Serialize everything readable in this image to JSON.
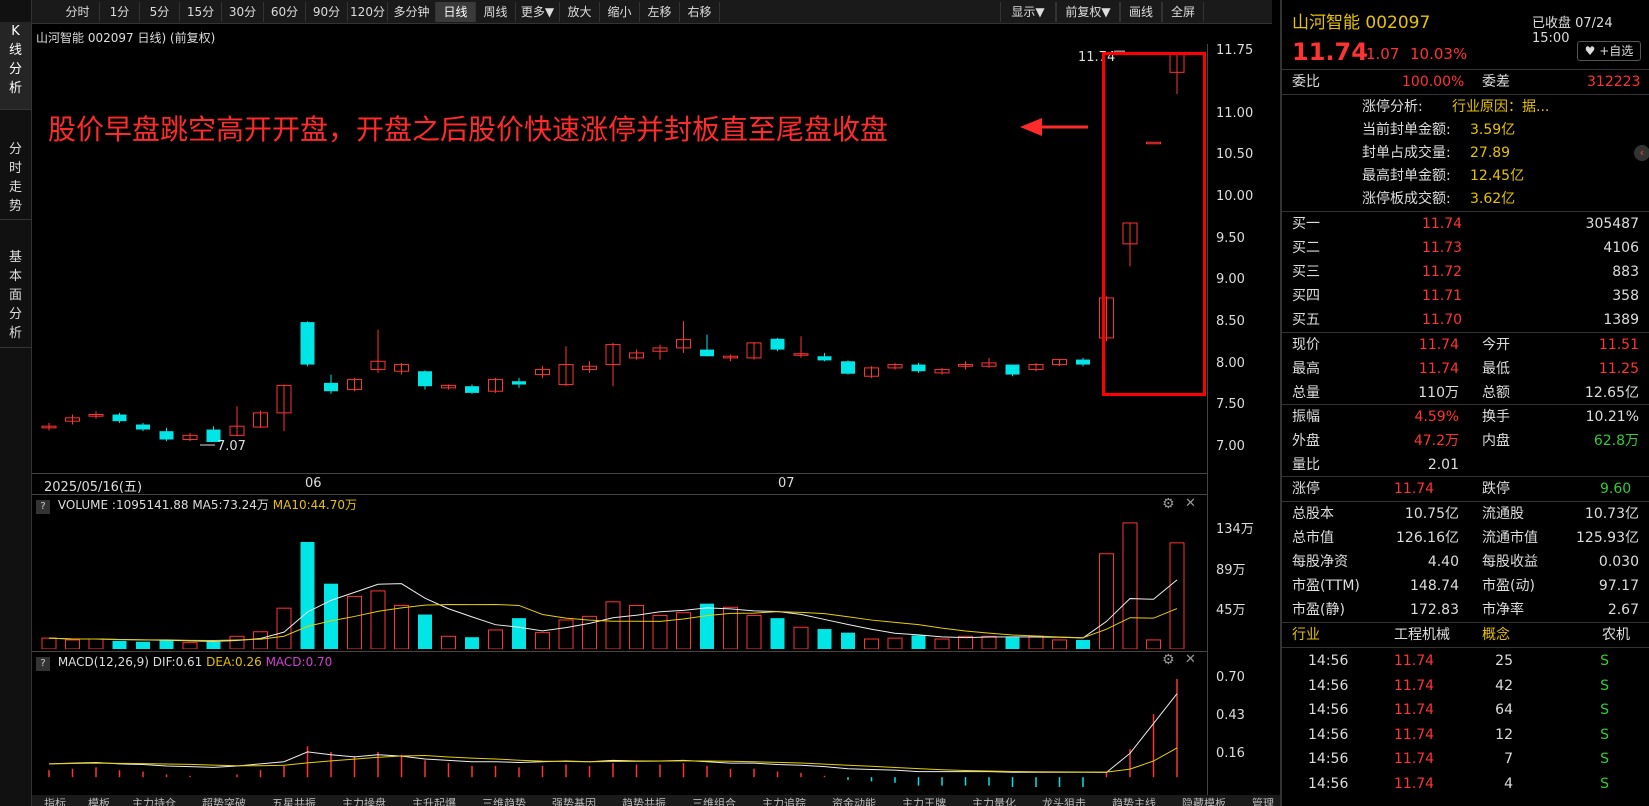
{
  "toolbar": {
    "buttons": [
      "分时",
      "1分",
      "5分",
      "15分",
      "30分",
      "60分",
      "90分",
      "120分",
      "多分钟",
      "日线",
      "周线",
      "更多▼",
      "放大",
      "缩小",
      "左移",
      "右移"
    ],
    "active": "日线",
    "right_buttons": [
      "显示▼",
      "前复权▼",
      "画线",
      "全屏"
    ]
  },
  "left_tabs": [
    "K\n线\n分\n析",
    "分\n时\n走\n势",
    "基\n本\n面\n分\n析"
  ],
  "chart": {
    "title": "山河智能 002097 日线) (前复权)",
    "annotation": "股价早盘跳空高开开盘，开盘之后股价快速涨停并封板直至尾盘收盘",
    "high_label": "11.74",
    "low_label": "7.07",
    "date_label": "2025/05/16(五)",
    "month_labels": [
      "06",
      "07"
    ],
    "y_ticks": [
      "11.75",
      "11.00",
      "10.50",
      "10.00",
      "9.50",
      "9.00",
      "8.50",
      "8.00",
      "7.50",
      "7.00"
    ]
  },
  "volume": {
    "label": "VOLUME",
    "value": ":1095141.88",
    "ma5": "MA5:73.24万",
    "ma10": "MA10:44.70万",
    "y_ticks": [
      "134万",
      "89万",
      "45万"
    ]
  },
  "macd": {
    "label": "MACD(12,26,9)",
    "dif": "DIF:0.61",
    "dea": "DEA:0.26",
    "macd": "MACD:0.70",
    "y_ticks": [
      "0.70",
      "0.43",
      "0.16"
    ]
  },
  "quote": {
    "name": "山河智能 002097",
    "status": "已收盘 07/24 15:00",
    "price": "11.74",
    "change": "1.07",
    "pct": "10.03%",
    "watch": "+自选",
    "weibi_label": "委比",
    "weibi": "100.00%",
    "weicha_label": "委差",
    "weicha": "312223",
    "limit": [
      {
        "label": "涨停分析:",
        "value": "行业原因：据..."
      },
      {
        "label": "当前封单金额:",
        "value": "3.59亿"
      },
      {
        "label": "封单占成交量:",
        "value": "27.89"
      },
      {
        "label": "最高封单金额:",
        "value": "12.45亿"
      },
      {
        "label": "涨停板成交额:",
        "value": "3.62亿"
      }
    ],
    "bids": [
      {
        "label": "买一",
        "price": "11.74",
        "vol": "305487"
      },
      {
        "label": "买二",
        "price": "11.73",
        "vol": "4106"
      },
      {
        "label": "买三",
        "price": "11.72",
        "vol": "883"
      },
      {
        "label": "买四",
        "price": "11.71",
        "vol": "358"
      },
      {
        "label": "买五",
        "price": "11.70",
        "vol": "1389"
      }
    ],
    "stats": [
      {
        "l1": "现价",
        "v1": "11.74",
        "c1": "red",
        "l2": "今开",
        "v2": "11.51",
        "c2": "red"
      },
      {
        "l1": "最高",
        "v1": "11.74",
        "c1": "red",
        "l2": "最低",
        "v2": "11.25",
        "c2": "red"
      },
      {
        "l1": "总量",
        "v1": "110万",
        "c1": "white",
        "l2": "总额",
        "v2": "12.65亿",
        "c2": "white"
      }
    ],
    "stats2": [
      {
        "l1": "振幅",
        "v1": "4.59%",
        "c1": "red",
        "l2": "换手",
        "v2": "10.21%",
        "c2": "white"
      },
      {
        "l1": "外盘",
        "v1": "47.2万",
        "c1": "red",
        "l2": "内盘",
        "v2": "62.8万",
        "c2": "green"
      },
      {
        "l1": "量比",
        "v1": "2.01",
        "c1": "white",
        "l2": "",
        "v2": "",
        "c2": "white"
      }
    ],
    "limits": {
      "up_label": "涨停",
      "up": "11.74",
      "down_label": "跌停",
      "down": "9.60"
    },
    "fund": [
      {
        "l1": "总股本",
        "v1": "10.75亿",
        "l2": "流通股",
        "v2": "10.73亿"
      },
      {
        "l1": "总市值",
        "v1": "126.16亿",
        "l2": "流通市值",
        "v2": "125.93亿"
      },
      {
        "l1": "每股净资",
        "v1": "4.40",
        "l2": "每股收益",
        "v2": "0.030"
      },
      {
        "l1": "市盈(TTM)",
        "v1": "148.74",
        "l2": "市盈(动)",
        "v2": "97.17"
      },
      {
        "l1": "市盈(静)",
        "v1": "172.83",
        "l2": "市净率",
        "v2": "2.67"
      }
    ],
    "industry": {
      "l1": "行业",
      "v1": "工程机械",
      "l2": "概念",
      "v2": "农机"
    },
    "ticks": [
      {
        "t": "14:56",
        "p": "11.74",
        "v": "25",
        "s": "S"
      },
      {
        "t": "14:56",
        "p": "11.74",
        "v": "42",
        "s": "S"
      },
      {
        "t": "14:56",
        "p": "11.74",
        "v": "64",
        "s": "S"
      },
      {
        "t": "14:56",
        "p": "11.74",
        "v": "12",
        "s": "S"
      },
      {
        "t": "14:56",
        "p": "11.74",
        "v": "7",
        "s": "S"
      },
      {
        "t": "14:56",
        "p": "11.74",
        "v": "4",
        "s": "S"
      }
    ]
  },
  "bottom_tabs": [
    "指标",
    "模板",
    "主力持仓",
    "超势突破",
    "五星共振",
    "主力操盘",
    "主升起爆",
    "三维趋势",
    "强势基因",
    "趋势共振",
    "三维组合",
    "主力追踪",
    "资金动能",
    "主力王牌",
    "主力量化",
    "龙头狙击",
    "趋势主线",
    "隐藏模板",
    "管理"
  ],
  "candles": [
    [
      7.24,
      7.26,
      7.21,
      7.3
    ],
    [
      7.32,
      7.36,
      7.28,
      7.4
    ],
    [
      7.38,
      7.4,
      7.35,
      7.44
    ],
    [
      7.4,
      7.32,
      7.3,
      7.42
    ],
    [
      7.28,
      7.22,
      7.2,
      7.3
    ],
    [
      7.2,
      7.1,
      7.08,
      7.24
    ],
    [
      7.1,
      7.15,
      7.08,
      7.18
    ],
    [
      7.22,
      7.07,
      7.07,
      7.26
    ],
    [
      7.15,
      7.26,
      7.14,
      7.5
    ],
    [
      7.25,
      7.42,
      7.24,
      7.45
    ],
    [
      7.42,
      7.75,
      7.2,
      7.76
    ],
    [
      8.51,
      8.0,
      7.98,
      8.52
    ],
    [
      7.78,
      7.68,
      7.65,
      7.88
    ],
    [
      7.7,
      7.82,
      7.68,
      7.84
    ],
    [
      7.94,
      8.04,
      7.9,
      8.42
    ],
    [
      7.92,
      8.0,
      7.88,
      8.02
    ],
    [
      7.92,
      7.74,
      7.7,
      7.93
    ],
    [
      7.72,
      7.75,
      7.7,
      7.76
    ],
    [
      7.74,
      7.66,
      7.65,
      7.76
    ],
    [
      7.68,
      7.82,
      7.66,
      7.84
    ],
    [
      7.8,
      7.76,
      7.72,
      7.84
    ],
    [
      7.88,
      7.94,
      7.84,
      7.98
    ],
    [
      7.76,
      8.0,
      7.74,
      8.22
    ],
    [
      7.94,
      7.98,
      7.9,
      8.04
    ],
    [
      8.0,
      8.24,
      7.74,
      8.26
    ],
    [
      8.08,
      8.14,
      8.06,
      8.18
    ],
    [
      8.16,
      8.2,
      8.06,
      8.24
    ],
    [
      8.2,
      8.3,
      8.14,
      8.52
    ],
    [
      8.18,
      8.1,
      8.1,
      8.36
    ],
    [
      8.08,
      8.1,
      8.04,
      8.12
    ],
    [
      8.08,
      8.26,
      8.06,
      8.27
    ],
    [
      8.31,
      8.18,
      8.16,
      8.32
    ],
    [
      8.12,
      8.13,
      8.08,
      8.34
    ],
    [
      8.1,
      8.05,
      8.04,
      8.14
    ],
    [
      8.04,
      7.89,
      7.88,
      8.05
    ],
    [
      7.86,
      7.96,
      7.84,
      7.98
    ],
    [
      7.96,
      8.0,
      7.94,
      8.02
    ],
    [
      8.0,
      7.92,
      7.9,
      8.02
    ],
    [
      7.9,
      7.94,
      7.88,
      7.96
    ],
    [
      7.98,
      8.0,
      7.94,
      8.04
    ],
    [
      7.98,
      8.02,
      7.96,
      8.08
    ],
    [
      8.0,
      7.88,
      7.86,
      8.0
    ],
    [
      7.94,
      8.0,
      7.92,
      8.02
    ],
    [
      8.0,
      8.06,
      7.98,
      8.07
    ],
    [
      8.06,
      8.0,
      7.98,
      8.08
    ],
    [
      8.32,
      8.8,
      8.28,
      8.82
    ],
    [
      9.45,
      9.7,
      9.18,
      9.7
    ],
    [
      10.67,
      10.67,
      10.67,
      10.67
    ],
    [
      11.51,
      11.74,
      11.25,
      11.74
    ]
  ],
  "volumes": [
    12,
    10,
    11,
    9,
    8,
    10,
    7,
    8,
    14,
    19,
    45,
    118,
    72,
    58,
    64,
    48,
    38,
    14,
    13,
    21,
    34,
    18,
    32,
    36,
    52,
    48,
    37,
    40,
    50,
    46,
    37,
    34,
    24,
    22,
    18,
    11,
    12,
    15,
    11,
    14,
    14,
    13,
    14,
    10,
    10,
    105,
    139,
    10,
    117
  ],
  "macd_vals": [
    0.05,
    0.06,
    0.07,
    0.05,
    0.04,
    0.02,
    0.01,
    0.0,
    0.02,
    0.05,
    0.08,
    0.22,
    0.18,
    0.15,
    0.18,
    0.16,
    0.12,
    0.1,
    0.08,
    0.08,
    0.07,
    0.08,
    0.09,
    0.08,
    0.1,
    0.09,
    0.09,
    0.1,
    0.08,
    0.06,
    0.06,
    0.04,
    0.03,
    0.01,
    -0.02,
    -0.03,
    -0.04,
    -0.06,
    -0.06,
    -0.06,
    -0.06,
    -0.07,
    -0.07,
    -0.07,
    -0.07,
    0.04,
    0.2,
    0.45,
    0.7
  ]
}
